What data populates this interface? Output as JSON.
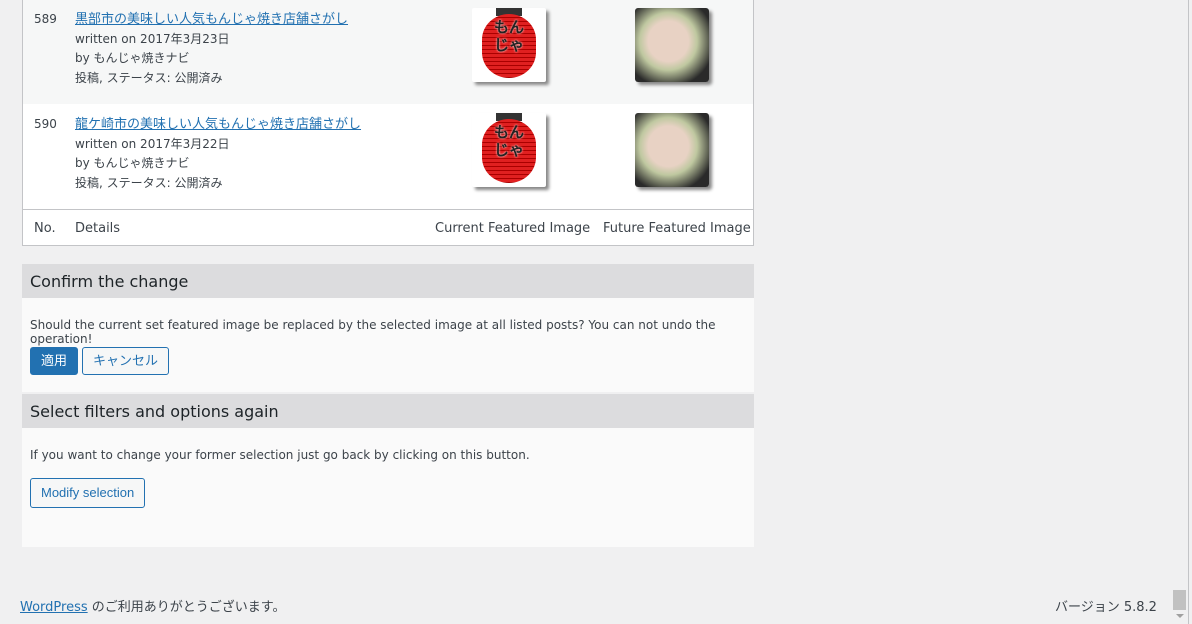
{
  "rows": [
    {
      "no": "589",
      "title": "黒部市の美味しい人気もんじゃ焼き店舗さがし",
      "written": "written on 2017年3月23日",
      "by": "by もんじゃ焼きナビ",
      "meta": "投稿, ステータス: 公開済み",
      "current_image": "もんじゃ",
      "future_image": "monjayaki-photo"
    },
    {
      "no": "590",
      "title": "龍ケ崎市の美味しい人気もんじゃ焼き店舗さがし",
      "written": "written on 2017年3月22日",
      "by": "by もんじゃ焼きナビ",
      "meta": "投稿, ステータス: 公開済み",
      "current_image": "もんじゃ",
      "future_image": "monjayaki-photo"
    }
  ],
  "columns": [
    "No.",
    "Details",
    "Current Featured Image",
    "Future Featured Image"
  ],
  "confirm": {
    "heading": "Confirm the change",
    "text": "Should the current set featured image be replaced by the selected image at all listed posts? You can not undo the operation!",
    "apply": "適用",
    "cancel": "キャンセル"
  },
  "again": {
    "heading": "Select filters and options again",
    "text": "If you want to change your former selection just go back by clicking on this button.",
    "modify": "Modify selection"
  },
  "footer": {
    "link": "WordPress",
    "thanks": " のご利用ありがとうございます。",
    "version": "バージョン 5.8.2"
  },
  "colors": {
    "accent": "#2271b1",
    "header_bg": "#dcdcde"
  }
}
